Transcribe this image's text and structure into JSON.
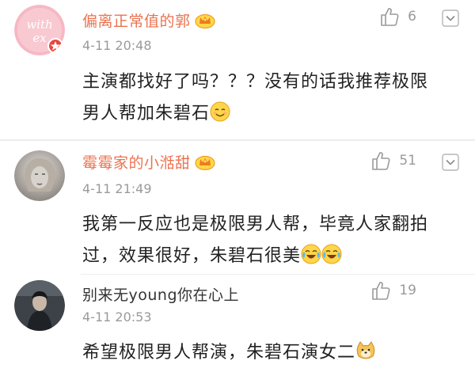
{
  "comments": [
    {
      "name": "偏离正常值的郭",
      "time": "4-11 20:48",
      "likes": "6",
      "avatar_text": "with\nex",
      "line1": "主演都找好了吗？？？没有的话我推荐极限",
      "line2": "男人帮加朱碧石"
    },
    {
      "name": "霉霉家的小湉甜",
      "time": "4-11 21:49",
      "likes": "51",
      "line1": "我第一反应也是极限男人帮，毕竟人家翻拍",
      "line2": "过，效果很好，朱碧石很美"
    },
    {
      "name": "别来无young你在心上",
      "time": "4-11 20:53",
      "likes": "19",
      "line1": "希望极限男人帮演，朱碧石演女二"
    }
  ],
  "colors": {
    "vip_name": "#eb7350",
    "normal_name": "#333333",
    "meta": "#9a9a9a",
    "text": "#222222"
  }
}
